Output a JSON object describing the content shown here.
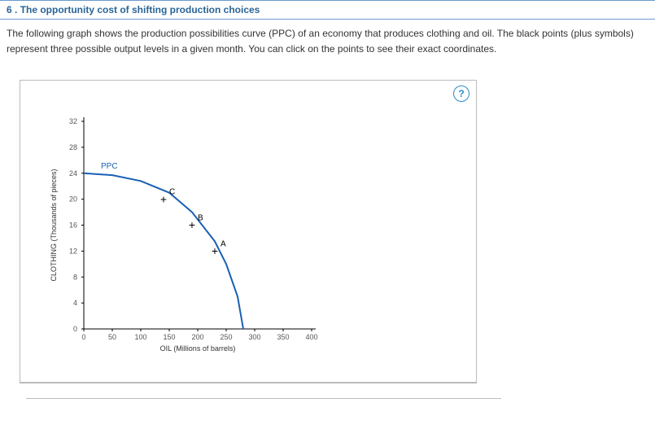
{
  "header": {
    "number": "6 .",
    "title": "The opportunity cost of shifting production choices"
  },
  "description": "The following graph shows the production possibilities curve (PPC) of an economy that produces clothing and oil. The black points (plus symbols) represent three possible output levels in a given month. You can click on the points to see their exact coordinates.",
  "help": "?",
  "chart_data": {
    "type": "line",
    "title": "",
    "xlabel": "OIL (Millions of barrels)",
    "ylabel": "CLOTHING (Thousands of pieces)",
    "xlim": [
      0,
      400
    ],
    "ylim": [
      0,
      32
    ],
    "xticks": [
      0,
      50,
      100,
      150,
      200,
      250,
      300,
      350,
      400
    ],
    "yticks": [
      0,
      4,
      8,
      12,
      16,
      20,
      24,
      28,
      32
    ],
    "series": [
      {
        "name": "PPC",
        "color": "#1a5fb4",
        "x": [
          0,
          50,
          100,
          150,
          190,
          230,
          250,
          270,
          280
        ],
        "y": [
          24,
          23.7,
          22.8,
          21,
          18,
          13.5,
          10,
          5,
          0
        ]
      }
    ],
    "points": [
      {
        "name": "C",
        "x": 140,
        "y": 20
      },
      {
        "name": "B",
        "x": 190,
        "y": 16
      },
      {
        "name": "A",
        "x": 230,
        "y": 12
      }
    ],
    "ppc_label": "PPC"
  }
}
